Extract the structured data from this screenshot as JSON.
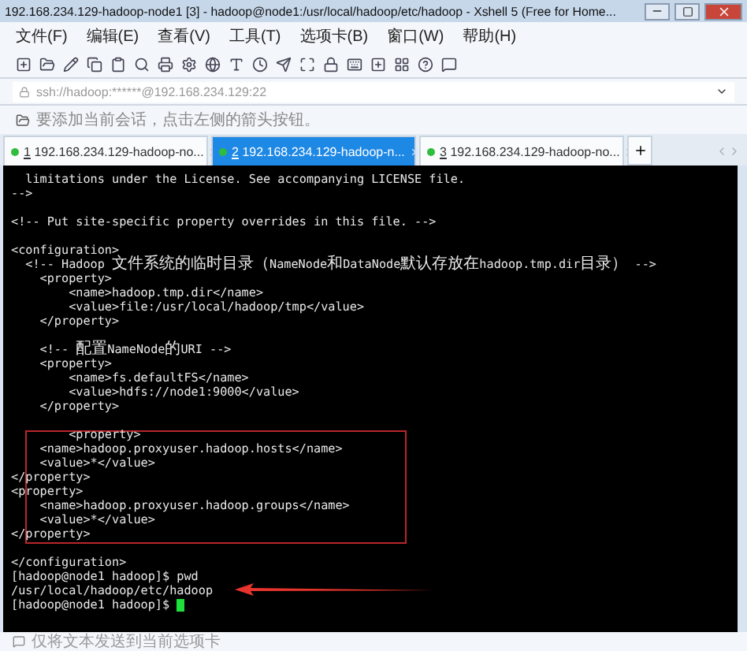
{
  "window": {
    "title": "192.168.234.129-hadoop-node1 [3] - hadoop@node1:/usr/local/hadoop/etc/hadoop - Xshell 5 (Free for Home..."
  },
  "menu": [
    "文件(F)",
    "编辑(E)",
    "查看(V)",
    "工具(T)",
    "选项卡(B)",
    "窗口(W)",
    "帮助(H)"
  ],
  "address": {
    "value": "ssh://hadoop:******@192.168.234.129:22"
  },
  "hint": "要添加当前会话，点击左侧的箭头按钮。",
  "tabs": [
    {
      "number": "1",
      "label": "192.168.234.129-hadoop-no...",
      "selected": false
    },
    {
      "number": "2",
      "label": "192.168.234.129-hadoop-n...",
      "selected": true
    },
    {
      "number": "3",
      "label": "192.168.234.129-hadoop-no...",
      "selected": false
    }
  ],
  "terminal": {
    "blocks": [
      {
        "highlighted": false,
        "lines": [
          {
            "kind": "text",
            "text": "  limitations under the License. See accompanying LICENSE file.",
            "pointed": false,
            "cursor": false
          },
          {
            "kind": "text",
            "text": "-->",
            "pointed": false,
            "cursor": false
          },
          {
            "kind": "blank"
          },
          {
            "kind": "text",
            "text": "<!-- Put site-specific property overrides in this file. -->",
            "pointed": false,
            "cursor": false
          },
          {
            "kind": "blank"
          },
          {
            "kind": "text",
            "text": "<configuration>",
            "pointed": false,
            "cursor": false
          },
          {
            "kind": "text",
            "text": "  <!-- Hadoop 文件系统的临时目录（NameNode和DataNode默认存放在hadoop.tmp.dir目录） -->",
            "pointed": false,
            "cursor": false
          },
          {
            "kind": "text",
            "text": "    <property>",
            "pointed": false,
            "cursor": false
          },
          {
            "kind": "text",
            "text": "        <name>hadoop.tmp.dir</name>",
            "pointed": false,
            "cursor": false
          },
          {
            "kind": "text",
            "text": "        <value>file:/usr/local/hadoop/tmp</value>",
            "pointed": false,
            "cursor": false
          },
          {
            "kind": "text",
            "text": "    </property>",
            "pointed": false,
            "cursor": false
          },
          {
            "kind": "blank"
          },
          {
            "kind": "text",
            "text": "    <!-- 配置NameNode的URI -->",
            "pointed": false,
            "cursor": false
          },
          {
            "kind": "text",
            "text": "    <property>",
            "pointed": false,
            "cursor": false
          },
          {
            "kind": "text",
            "text": "        <name>fs.defaultFS</name>",
            "pointed": false,
            "cursor": false
          },
          {
            "kind": "text",
            "text": "        <value>hdfs://node1:9000</value>",
            "pointed": false,
            "cursor": false
          },
          {
            "kind": "text",
            "text": "    </property>",
            "pointed": false,
            "cursor": false
          },
          {
            "kind": "blank"
          }
        ]
      },
      {
        "highlighted": true,
        "lines": [
          {
            "kind": "text",
            "text": "        <property>",
            "pointed": false,
            "cursor": false
          },
          {
            "kind": "text",
            "text": "    <name>hadoop.proxyuser.hadoop.hosts</name>",
            "pointed": false,
            "cursor": false
          },
          {
            "kind": "text",
            "text": "    <value>*</value>",
            "pointed": false,
            "cursor": false
          },
          {
            "kind": "text",
            "text": "</property>",
            "pointed": false,
            "cursor": false
          },
          {
            "kind": "text",
            "text": "<property>",
            "pointed": false,
            "cursor": false
          },
          {
            "kind": "text",
            "text": "    <name>hadoop.proxyuser.hadoop.groups</name>",
            "pointed": false,
            "cursor": false
          },
          {
            "kind": "text",
            "text": "    <value>*</value>",
            "pointed": false,
            "cursor": false
          },
          {
            "kind": "text",
            "text": "</property>",
            "pointed": false,
            "cursor": false
          }
        ]
      },
      {
        "highlighted": false,
        "lines": [
          {
            "kind": "blank"
          },
          {
            "kind": "text",
            "text": "</configuration>",
            "pointed": false,
            "cursor": false
          },
          {
            "kind": "text",
            "text": "[hadoop@node1 hadoop]$ pwd",
            "pointed": false,
            "cursor": false
          },
          {
            "kind": "text",
            "text": "/usr/local/hadoop/etc/hadoop",
            "pointed": true,
            "cursor": false
          },
          {
            "kind": "text",
            "text": "[hadoop@node1 hadoop]$ ",
            "pointed": false,
            "cursor": true
          }
        ]
      }
    ]
  },
  "compose_bar": {
    "text": "仅将文本发送到当前选项卡"
  }
}
